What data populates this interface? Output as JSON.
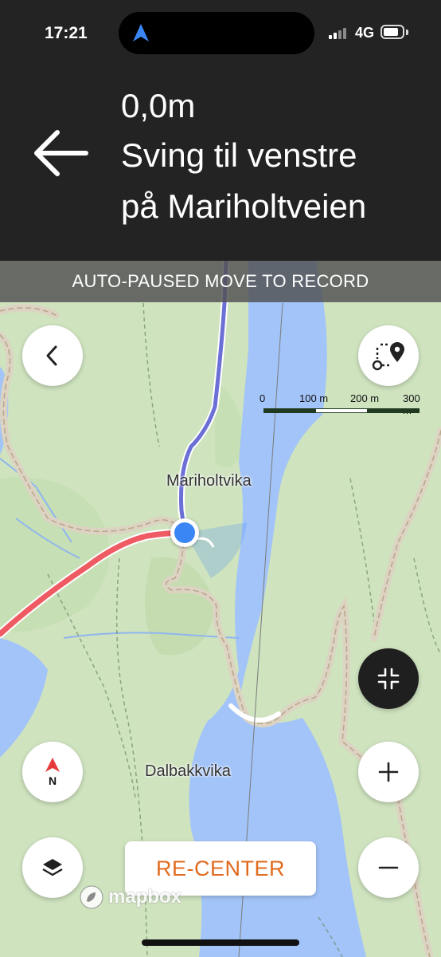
{
  "status_bar": {
    "time": "17:21",
    "network": "4G"
  },
  "instruction": {
    "distance": "0,0m",
    "line1": "Sving til venstre",
    "line2": "på Mariholtveien"
  },
  "banner": {
    "text": "AUTO-PAUSED MOVE TO RECORD"
  },
  "scale_bar": {
    "labels": [
      "0",
      "100 m",
      "200 m",
      "300 m"
    ]
  },
  "map_labels": {
    "place1": "Mariholtvika",
    "place2": "Dalbakkvika"
  },
  "buttons": {
    "recenter_label": "RE-CENTER",
    "compass_label": "N"
  },
  "attribution": {
    "text": "mapbox"
  },
  "colors": {
    "route_planned": "#6b6fd6",
    "route_recorded": "#ef5b63",
    "accent": "#e06b1e",
    "location": "#3a86f5",
    "water": "#a3c4f8",
    "land": "#cfe3bf"
  }
}
